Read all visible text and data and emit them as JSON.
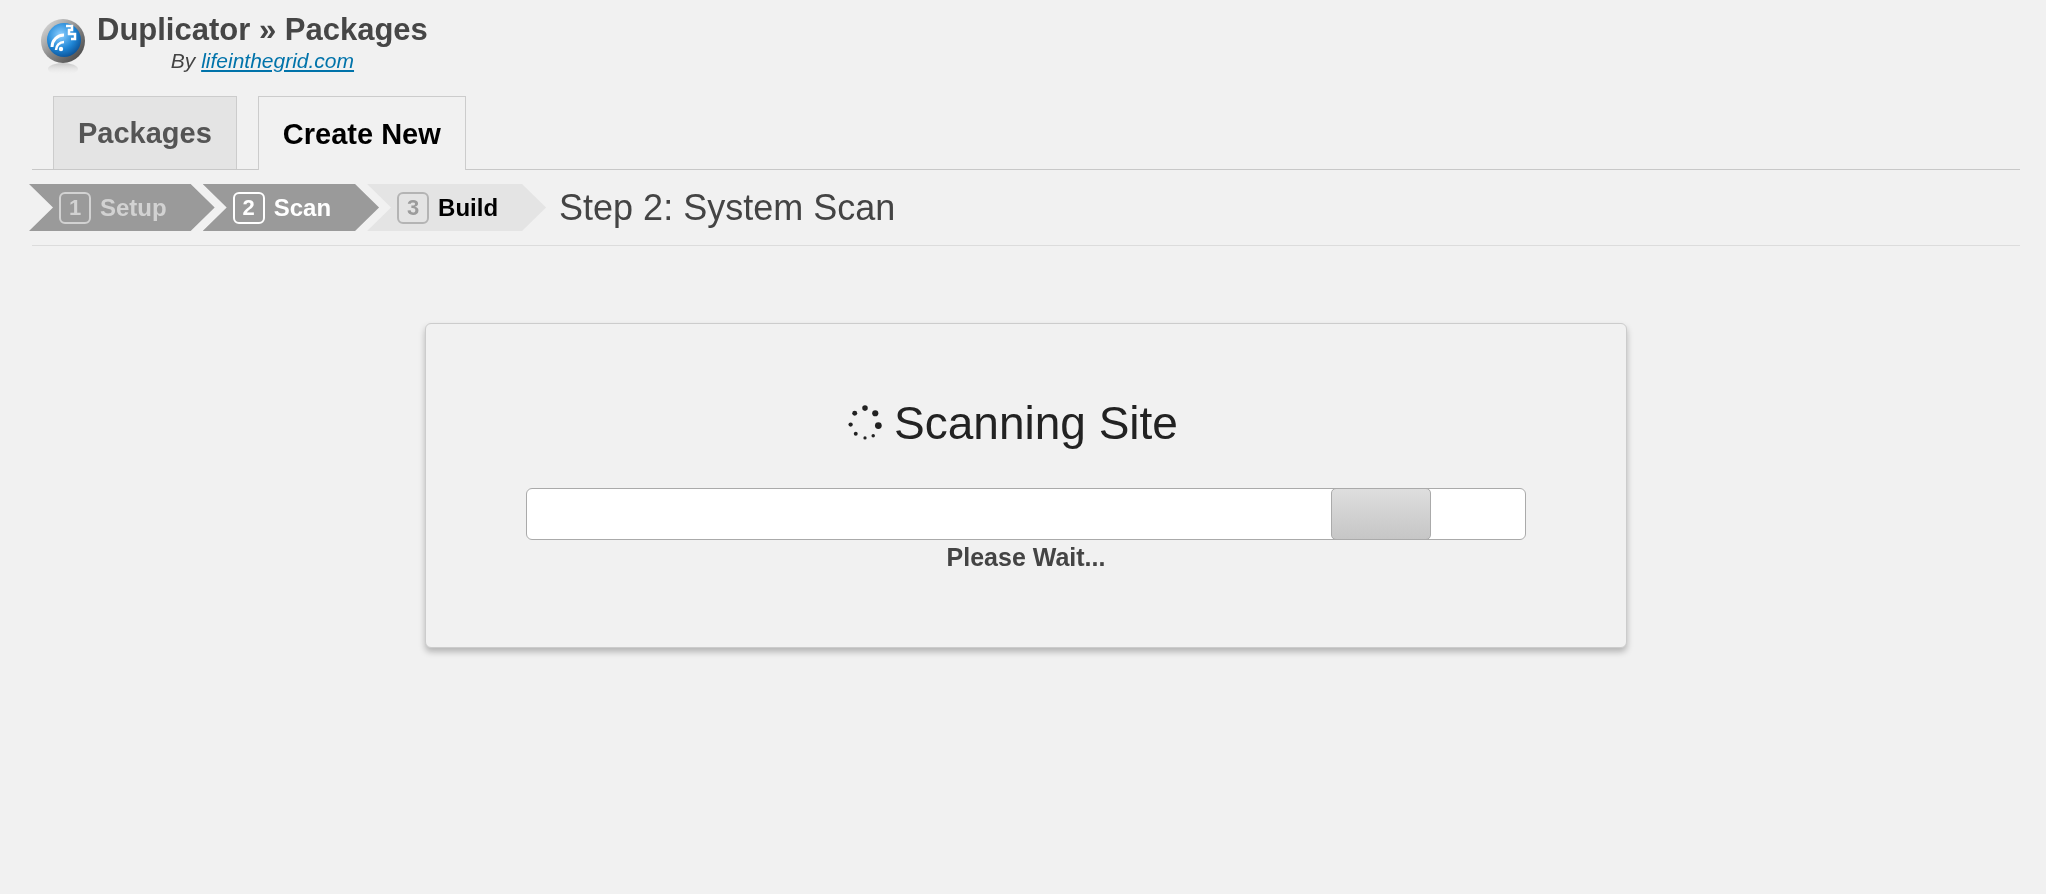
{
  "header": {
    "title": "Duplicator » Packages",
    "byline": {
      "prefix": "By",
      "link": "lifeinthegrid.com"
    }
  },
  "tabs": [
    {
      "label": "Packages",
      "selected": false
    },
    {
      "label": "Create New",
      "selected": true
    }
  ],
  "wizard": {
    "steps": [
      {
        "number": "1",
        "label": "Setup",
        "completed": true,
        "selected": false
      },
      {
        "number": "2",
        "label": "Scan",
        "completed": false,
        "selected": true
      },
      {
        "number": "3",
        "label": "Build",
        "completed": false,
        "selected": false
      }
    ],
    "heading": "Step 2: System Scan"
  },
  "scan_panel": {
    "heading": "Scanning Site",
    "message": "Please Wait..."
  }
}
